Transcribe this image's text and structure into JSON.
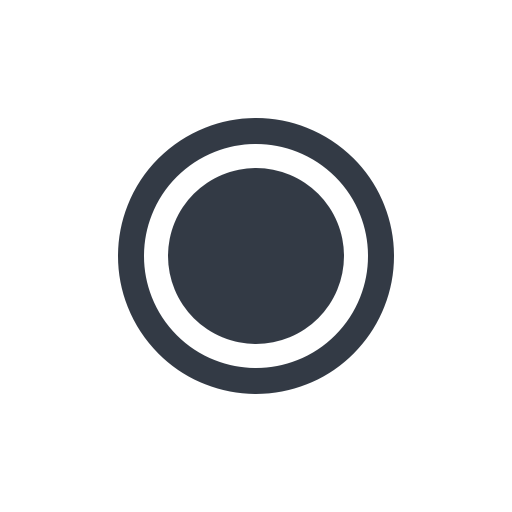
{
  "icon": {
    "name": "radio-button-checked-icon",
    "color": "#333a45",
    "background": "#ffffff"
  }
}
